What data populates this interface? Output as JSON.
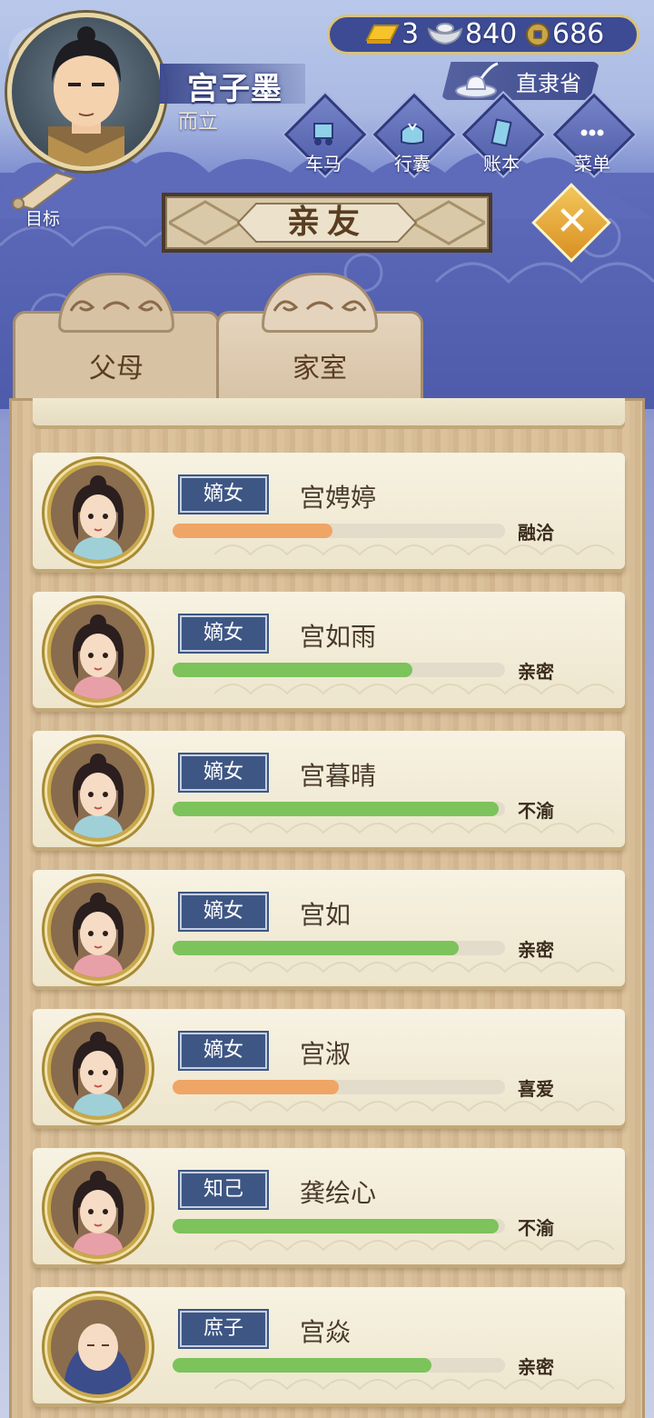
{
  "player": {
    "name": "宫子墨",
    "title": "而立"
  },
  "resources": {
    "gold": "3",
    "silver": "840",
    "coins": "686"
  },
  "location": {
    "label": "直隶省"
  },
  "menu_buttons": [
    {
      "label": "车马",
      "icon": "carriage-icon"
    },
    {
      "label": "行囊",
      "icon": "bundle-icon"
    },
    {
      "label": "账本",
      "icon": "ledger-icon"
    },
    {
      "label": "菜单",
      "icon": "more-icon"
    }
  ],
  "goal": {
    "label": "目标",
    "icon": "scroll-icon"
  },
  "page_title": "亲友",
  "tabs": [
    {
      "label": "父母",
      "active": false
    },
    {
      "label": "家室",
      "active": true
    }
  ],
  "colors": {
    "bar_orange": "#efa566",
    "bar_green": "#7cc35c",
    "tag_blue": "#3e5684"
  },
  "relatives": [
    {
      "tag": "嫡女",
      "name": "宫娉婷",
      "status": "融洽",
      "affinity": 0.48,
      "bar_color": "orange"
    },
    {
      "tag": "嫡女",
      "name": "宫如雨",
      "status": "亲密",
      "affinity": 0.72,
      "bar_color": "green"
    },
    {
      "tag": "嫡女",
      "name": "宫暮晴",
      "status": "不渝",
      "affinity": 0.98,
      "bar_color": "green"
    },
    {
      "tag": "嫡女",
      "name": "宫如",
      "status": "亲密",
      "affinity": 0.86,
      "bar_color": "green"
    },
    {
      "tag": "嫡女",
      "name": "宫淑",
      "status": "喜爱",
      "affinity": 0.5,
      "bar_color": "orange"
    },
    {
      "tag": "知己",
      "name": "龚绘心",
      "status": "不渝",
      "affinity": 0.98,
      "bar_color": "green"
    },
    {
      "tag": "庶子",
      "name": "宫焱",
      "status": "亲密",
      "affinity": 0.78,
      "bar_color": "green"
    }
  ]
}
